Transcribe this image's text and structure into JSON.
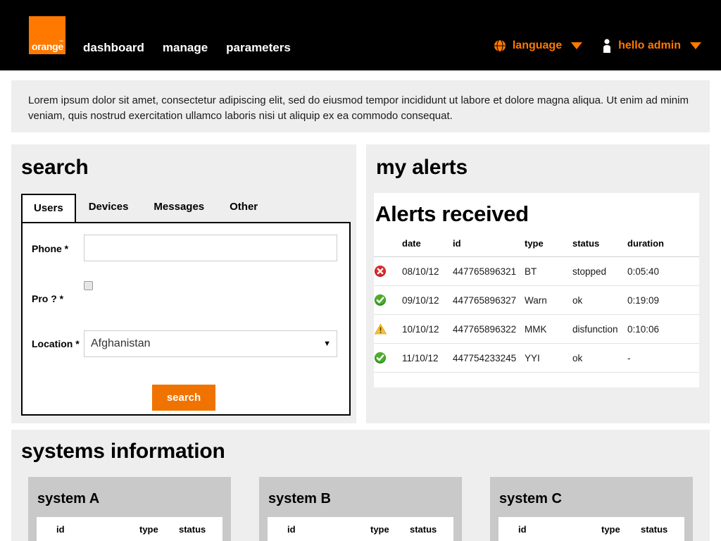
{
  "header": {
    "logo": {
      "text": "orange",
      "tm": "™",
      "color": "#ff7900"
    },
    "nav": [
      {
        "label": "dashboard"
      },
      {
        "label": "manage"
      },
      {
        "label": "parameters"
      }
    ],
    "language": {
      "icon": "globe-icon",
      "label": "language",
      "caret": "▼"
    },
    "user": {
      "icon": "person-icon",
      "label": "hello admin",
      "caret": "▼"
    },
    "accent_color": "#ff7900",
    "background_color": "#000000"
  },
  "intro": {
    "text": "Lorem ipsum dolor sit amet, consectetur adipiscing elit, sed do eiusmod tempor incididunt ut labore et dolore magna aliqua. Ut enim ad minim veniam, quis nostrud exercitation ullamco laboris nisi ut aliquip ex ea commodo consequat."
  },
  "search": {
    "title": "search",
    "tabs": [
      {
        "label": "Users",
        "active": true
      },
      {
        "label": "Devices",
        "active": false
      },
      {
        "label": "Messages",
        "active": false
      },
      {
        "label": "Other",
        "active": false
      }
    ],
    "fields": {
      "phone": {
        "label": "Phone *",
        "value": "",
        "placeholder": ""
      },
      "pro": {
        "label": "Pro ? *",
        "checked": false
      },
      "location": {
        "label": "Location *",
        "value": "Afghanistan",
        "arrow": "▼"
      }
    },
    "submit_label": "search",
    "submit_color": "#f07300"
  },
  "alerts": {
    "title": "my alerts",
    "heading": "Alerts received",
    "columns": [
      "",
      "date",
      "id",
      "type",
      "status",
      "duration"
    ],
    "rows": [
      {
        "icon": "error-icon",
        "date": "08/10/12",
        "id": "447765896321",
        "type": "BT",
        "status": "stopped",
        "status_class": "st-stopped",
        "duration": "0:05:40"
      },
      {
        "icon": "success-icon",
        "date": "09/10/12",
        "id": "447765896327",
        "type": "Warn",
        "status": "ok",
        "status_class": "st-ok",
        "duration": "0:19:09"
      },
      {
        "icon": "warning-icon",
        "date": "10/10/12",
        "id": "447765896322",
        "type": "MMK",
        "status": "disfunction",
        "status_class": "st-disfunction",
        "duration": "0:10:06"
      },
      {
        "icon": "success-icon",
        "date": "11/10/12",
        "id": "447754233245",
        "type": "YYI",
        "status": "ok",
        "status_class": "st-ok",
        "duration": "-"
      }
    ],
    "status_colors": {
      "stopped": "#ee1c25",
      "ok": "#2f9e2f",
      "disfunction": "#ff7900"
    }
  },
  "systems": {
    "title": "systems information",
    "columns": [
      "id",
      "type",
      "status"
    ],
    "cards": [
      {
        "name": "system A"
      },
      {
        "name": "system B"
      },
      {
        "name": "system C"
      }
    ]
  }
}
